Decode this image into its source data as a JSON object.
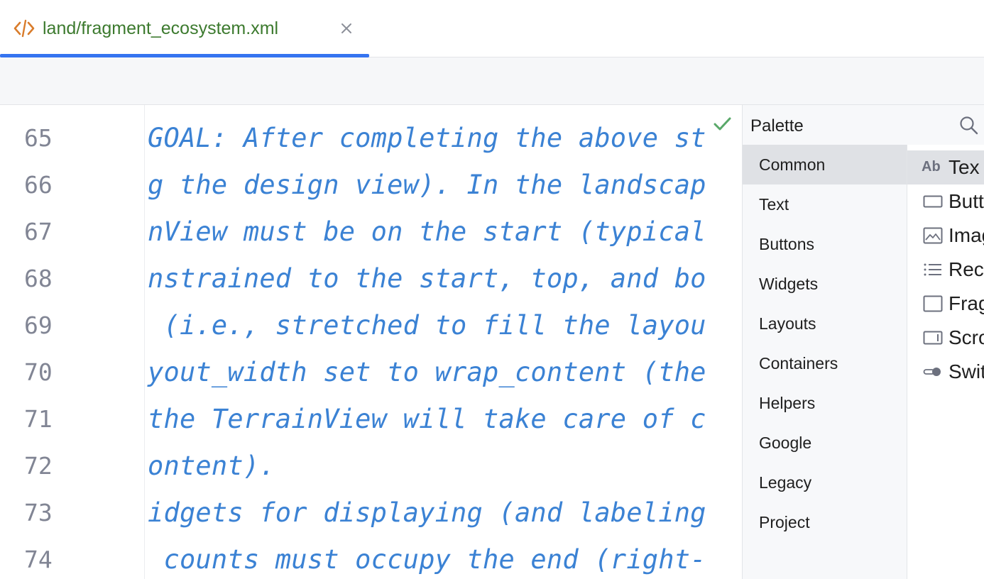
{
  "tab": {
    "label": "land/fragment_ecosystem.xml",
    "icon": "xml-tag-icon"
  },
  "editor": {
    "lines": [
      {
        "number": "65",
        "text": "GOAL: After completing the above st"
      },
      {
        "number": "66",
        "text": "g the design view). In the landscap"
      },
      {
        "number": "67",
        "text": "nView must be on the start (typical"
      },
      {
        "number": "68",
        "text": "nstrained to the start, top, and bo"
      },
      {
        "number": "69",
        "text": " (i.e., stretched to fill the layou"
      },
      {
        "number": "70",
        "text": "yout_width set to wrap_content (the"
      },
      {
        "number": "71",
        "text": "the TerrainView will take care of c"
      },
      {
        "number": "72",
        "text": "ontent)."
      },
      {
        "number": "73",
        "text": "idgets for displaying (and labeling"
      },
      {
        "number": "74",
        "text": " counts must occupy the end (right-"
      }
    ]
  },
  "palette": {
    "title": "Palette",
    "categories": [
      "Common",
      "Text",
      "Buttons",
      "Widgets",
      "Layouts",
      "Containers",
      "Helpers",
      "Google",
      "Legacy",
      "Project"
    ],
    "items": [
      {
        "label": "Tex",
        "icon": "textview-icon",
        "icon_text": "Ab"
      },
      {
        "label": "Butt",
        "icon": "button-icon"
      },
      {
        "label": "Imag",
        "icon": "imageview-icon"
      },
      {
        "label": "Rec",
        "icon": "recyclerview-icon"
      },
      {
        "label": "Frag",
        "icon": "fragment-icon"
      },
      {
        "label": "Scro",
        "icon": "scrollview-icon"
      },
      {
        "label": "Swit",
        "icon": "switch-icon"
      }
    ]
  },
  "colors": {
    "accent": "#3574f0",
    "tab_text": "#3c7a2e",
    "code_text": "#3b82d4",
    "check": "#59a869"
  }
}
